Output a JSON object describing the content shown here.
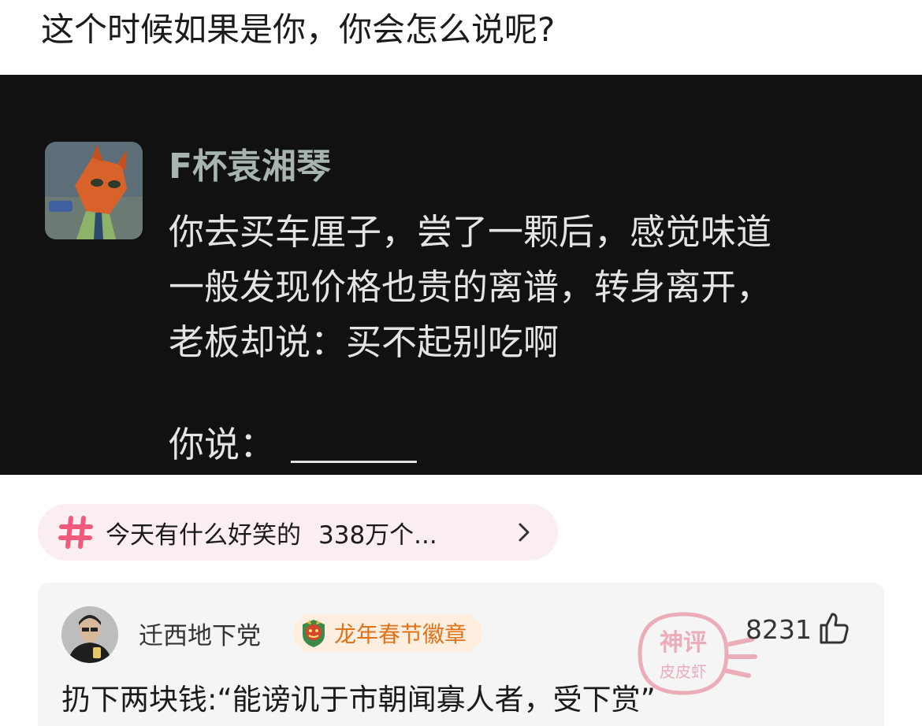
{
  "post": {
    "title": "这个时候如果是你，你会怎么说呢?"
  },
  "image": {
    "sender_name": "F杯袁湘琴",
    "message_lines": [
      "你去买车厘子，尝了一颗后，感觉味道",
      "一般发现价格也贵的离谱，转身离开，",
      "老板却说：买不起别吃啊"
    ],
    "prompt": "你说："
  },
  "topic": {
    "name": "今天有什么好笑的",
    "count": "338万个..."
  },
  "comment": {
    "username": "迁西地下党",
    "badge": "龙年春节徽章",
    "likes": "8231",
    "text": "扔下两块钱:“能谤讥于市朝闻寡人者，受下赏”",
    "watermark_top": "神评",
    "watermark_bottom": "皮皮虾"
  },
  "colors": {
    "accent_pink": "#f05a7a",
    "badge_orange": "#e0721a",
    "image_bg": "#111112"
  },
  "icons": {
    "topic": "hashtag-icon",
    "chevron": "chevron-right-icon",
    "like": "thumbs-up-icon",
    "badge": "dragon-badge-icon"
  }
}
